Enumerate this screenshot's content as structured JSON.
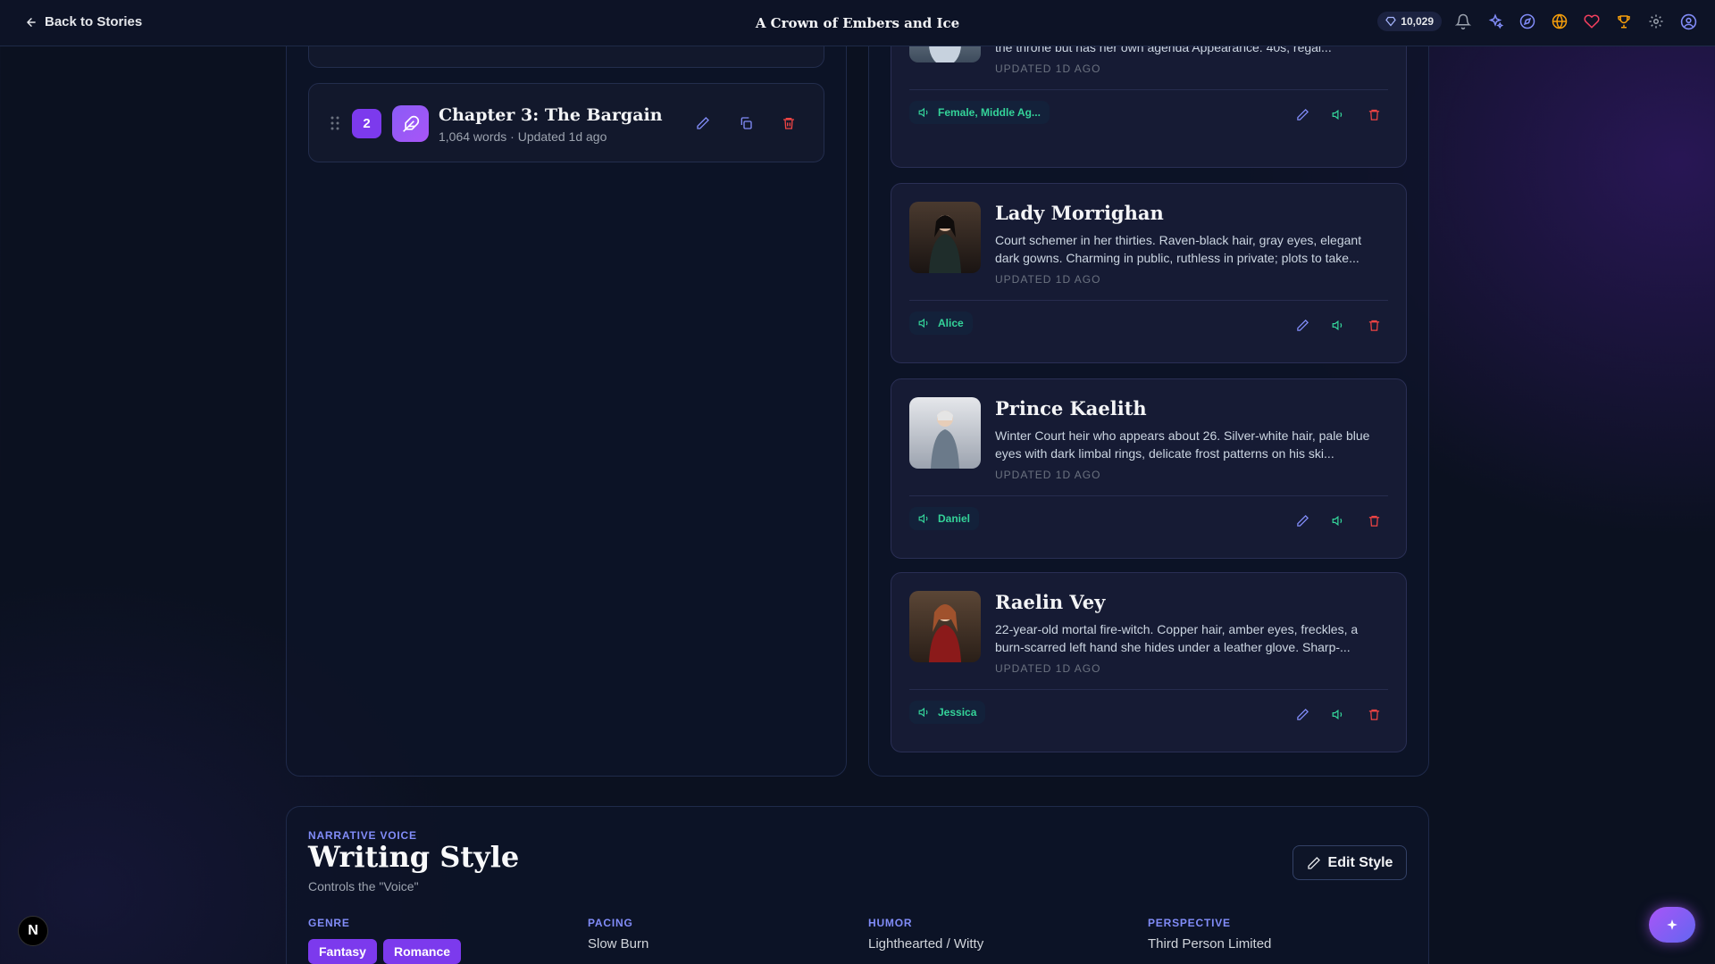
{
  "topbar": {
    "back_label": "Back to Stories",
    "title": "A Crown of Embers and Ice",
    "gems": "10,029",
    "icons": [
      "bell-icon",
      "sparkles-icon",
      "compass-icon",
      "globe-icon",
      "heart-icon",
      "trophy-icon",
      "gear-icon",
      "user-icon"
    ]
  },
  "chapter": {
    "number": "2",
    "title": "Chapter 3: The Bargain",
    "meta": "1,064 words · Updated 1d ago"
  },
  "characters": [
    {
      "name": "",
      "description": "The Winter Court's cunning spymaster, elegant, manipulative, loyal to the throne but has her own agenda Appearance: 40s, regal...",
      "updated": "UPDATED 1D AGO",
      "voice": "Female, Middle Ag..."
    },
    {
      "name": "Lady Morrighan",
      "description": "Court schemer in her thirties. Raven-black hair, gray eyes, elegant dark gowns. Charming in public, ruthless in private; plots to take...",
      "updated": "UPDATED 1D AGO",
      "voice": "Alice"
    },
    {
      "name": "Prince Kaelith",
      "description": "Winter Court heir who appears about 26. Silver-white hair, pale blue eyes with dark limbal rings, delicate frost patterns on his ski...",
      "updated": "UPDATED 1D AGO",
      "voice": "Daniel"
    },
    {
      "name": "Raelin Vey",
      "description": "22-year-old mortal fire-witch. Copper hair, amber eyes, freckles, a burn-scarred left hand she hides under a leather glove. Sharp-...",
      "updated": "UPDATED 1D AGO",
      "voice": "Jessica"
    }
  ],
  "writing_style": {
    "eyebrow": "NARRATIVE VOICE",
    "title": "Writing Style",
    "subtitle": "Controls the \"Voice\"",
    "edit_label": "Edit Style",
    "genre_label": "GENRE",
    "genres": [
      "Fantasy",
      "Romance"
    ],
    "pacing_label": "PACING",
    "pacing": "Slow Burn",
    "humor_label": "HUMOR",
    "humor": "Lighthearted / Witty",
    "perspective_label": "PERSPECTIVE",
    "perspective": "Third Person Limited"
  },
  "colors": {
    "accent": "#7c3aed",
    "voice_green": "#34d399",
    "danger": "#ef4444",
    "bg": "#0b1120"
  },
  "badge_letter": "N",
  "fab_icon": "sparkle-icon"
}
